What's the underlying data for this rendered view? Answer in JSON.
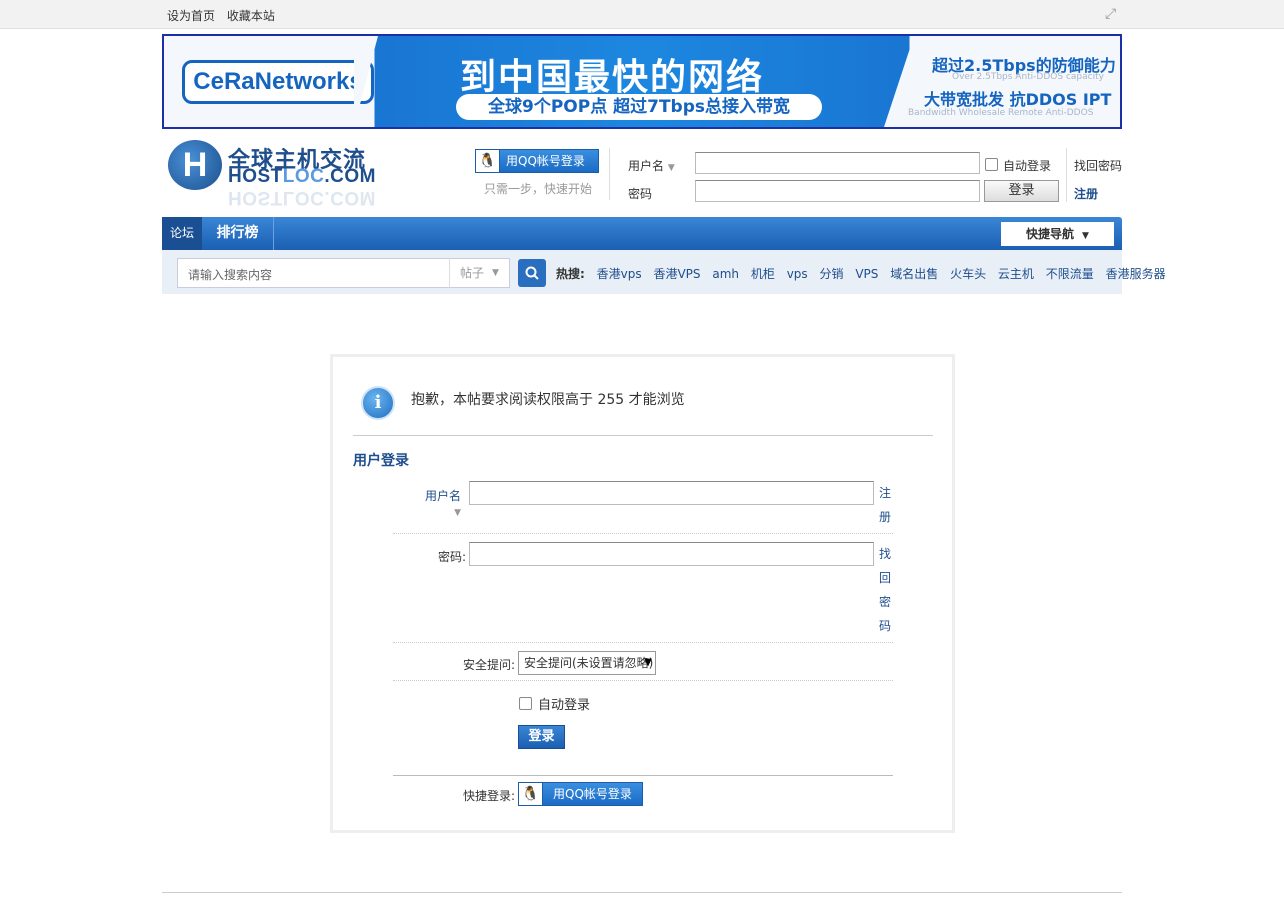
{
  "topbar": {
    "home_link": "设为首页",
    "fav_link": "收藏本站"
  },
  "banner": {
    "brand": "CeRaNetworks",
    "headline": "到中国最快的网络",
    "pill": "全球9个POP点 超过7Tbps总接入带宽",
    "right_title1": "超过2.5Tbps的防御能力",
    "right_sub1": "Over 2.5Tbps Anti-DDOS capacity",
    "right_title2": "大带宽批发 抗DDOS IPT",
    "right_sub2": "Bandwidth Wholesale Remote Anti-DDOS"
  },
  "logo": {
    "mark": "H",
    "cn": "全球主机交流",
    "en_a": "HOST",
    "en_b": "LOC",
    "en_c": ".COM",
    "reflection": "HOSTLOC.COM"
  },
  "header_login": {
    "qq_button": "用QQ帐号登录",
    "qq_hint": "只需一步，快速开始",
    "username_label": "用户名",
    "password_label": "密码",
    "remember_label": "自动登录",
    "login_button": "登录",
    "forgot_link": "找回密码",
    "register_link": "注册"
  },
  "nav": {
    "home": "论坛",
    "items": [
      "排行榜"
    ],
    "quick_nav": "快捷导航"
  },
  "search": {
    "placeholder": "请输入搜索内容",
    "scope": "帖子",
    "hot_label": "热搜:",
    "hot_tags": [
      "香港vps",
      "香港VPS",
      "amh",
      "机柜",
      "vps",
      "分销",
      "VPS",
      "域名出售",
      "火车头",
      "云主机",
      "不限流量",
      "香港服务器"
    ]
  },
  "message": {
    "text": "抱歉，本帖要求阅读权限高于 255 才能浏览",
    "section_title": "用户登录"
  },
  "login_form": {
    "username_label": "用户名",
    "register_link": "注册",
    "password_label": "密码:",
    "forgot_link": "找回密码",
    "security_label": "安全提问:",
    "security_selected": "安全提问(未设置请忽略)",
    "remember_label": "自动登录",
    "submit_button": "登录",
    "quick_label": "快捷登录:",
    "qq_button": "用QQ帐号登录"
  },
  "icons": {
    "fullscreen": "fullscreen-icon",
    "qq": "qq-penguin-icon",
    "search": "search-icon",
    "info": "info-icon"
  },
  "colors": {
    "primary_blue": "#1b5fb2",
    "link_blue": "#1f4e8c",
    "search_bg": "#e8eff7"
  }
}
